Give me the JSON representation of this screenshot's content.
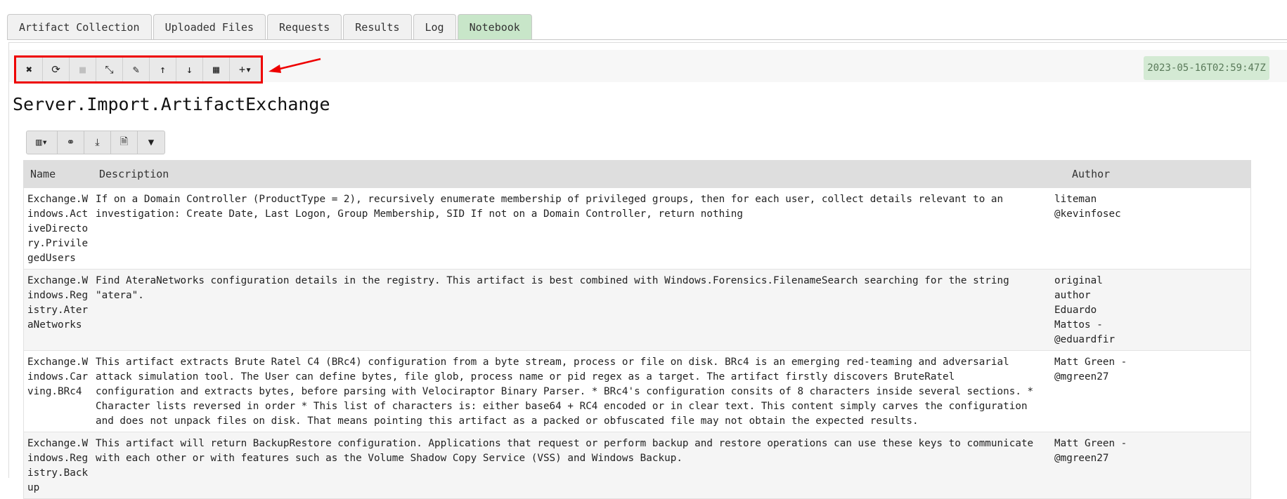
{
  "tabs": [
    "Artifact Collection",
    "Uploaded Files",
    "Requests",
    "Results",
    "Log",
    "Notebook"
  ],
  "active_tab": "Notebook",
  "cell_toolbar": [
    {
      "name": "close-cell",
      "icon": "close-square-icon",
      "glyph": "✖"
    },
    {
      "name": "recalculate",
      "icon": "refresh-icon",
      "glyph": "⟳"
    },
    {
      "name": "stop",
      "icon": "stop-icon",
      "glyph": "■"
    },
    {
      "name": "collapse",
      "icon": "compress-icon",
      "glyph": "⤡"
    },
    {
      "name": "edit",
      "icon": "pencil-icon",
      "glyph": "✎"
    },
    {
      "name": "move-up",
      "icon": "arrow-up-icon",
      "glyph": "↑"
    },
    {
      "name": "move-down",
      "icon": "arrow-down-icon",
      "glyph": "↓"
    },
    {
      "name": "add-timeline",
      "icon": "calendar-icon",
      "glyph": "▦"
    },
    {
      "name": "add-cell",
      "icon": "plus-dropdown-icon",
      "glyph": "+▾"
    }
  ],
  "timestamp": "2023-05-16T02:59:47Z",
  "cell_title": "Server.Import.ArtifactExchange",
  "table_toolbar": [
    {
      "name": "column-selector",
      "icon": "columns-dropdown-icon",
      "glyph": "▥▾"
    },
    {
      "name": "search",
      "icon": "binoculars-icon",
      "glyph": "⚭"
    },
    {
      "name": "download",
      "icon": "download-icon",
      "glyph": "⤓"
    },
    {
      "name": "export-csv",
      "icon": "csv-file-icon",
      "glyph": "🗎"
    },
    {
      "name": "filter",
      "icon": "filter-icon",
      "glyph": "▼"
    }
  ],
  "columns": {
    "name": "Name",
    "description": "Description",
    "author": "Author"
  },
  "rows": [
    {
      "name": "Exchange.Windows.ActiveDirectory.PrivilegedUsers",
      "description": "If on a Domain Controller (ProductType = 2), recursively enumerate membership of privileged groups, then for each user, collect details relevant to an investigation: Create Date, Last Logon, Group Membership, SID If not on a Domain Controller, return nothing",
      "author": "liteman @kevinfosec"
    },
    {
      "name": "Exchange.Windows.Registry.AteraNetworks",
      "description": "Find AteraNetworks configuration details in the registry. This artifact is best combined with Windows.Forensics.FilenameSearch searching for the string \"atera\".",
      "author": "original author Eduardo Mattos - @eduardfir"
    },
    {
      "name": "Exchange.Windows.Carving.BRc4",
      "description": "This artifact extracts Brute Ratel C4 (BRc4) configuration from a byte stream, process or file on disk. BRc4 is an emerging red-teaming and adversarial attack simulation tool. The User can define bytes, file glob, process name or pid regex as a target. The artifact firstly discovers BruteRatel configuration and extracts bytes, before parsing with Velociraptor Binary Parser. * BRc4's configuration consits of 8 characters inside several sections. * Character lists reversed in order * This list of characters is: either base64 + RC4 encoded or in clear text. This content simply carves the configuration and does not unpack files on disk. That means pointing this artifact as a packed or obfuscated file may not obtain the expected results.",
      "author": "Matt Green - @mgreen27"
    },
    {
      "name": "Exchange.Windows.Registry.Backup",
      "description": "This artifact will return BackupRestore configuration. Applications that request or perform backup and restore operations can use these keys to communicate with each other or with features such as the Volume Shadow Copy Service (VSS) and Windows Backup.",
      "author": "Matt Green - @mgreen27"
    }
  ],
  "colors": {
    "highlight": "#e00000",
    "active_tab": "#c8e6c9",
    "timestamp_bg": "#d4ead4"
  }
}
